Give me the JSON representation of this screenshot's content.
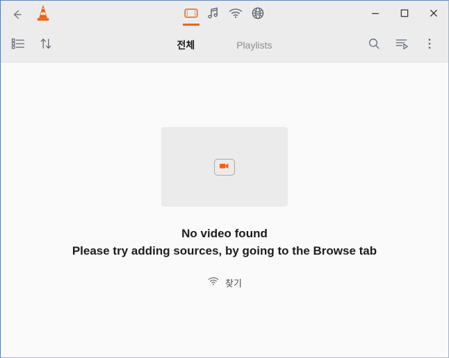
{
  "window": {
    "accent_color": "#f4610a",
    "titlebar_bg": "#ececec",
    "content_bg": "#fafafa"
  },
  "titlebar": {
    "back_label": "back-arrow",
    "app_logo": "vlc-cone-logo",
    "tabs": [
      {
        "id": "video",
        "icon": "video-filmstrip-icon",
        "selected": true
      },
      {
        "id": "music",
        "icon": "music-note-icon",
        "selected": false
      },
      {
        "id": "network",
        "icon": "wifi-icon",
        "selected": false
      },
      {
        "id": "browse",
        "icon": "globe-icon",
        "selected": false
      }
    ],
    "window_controls": [
      {
        "id": "minimize",
        "icon": "minimize-icon"
      },
      {
        "id": "maximize",
        "icon": "maximize-icon"
      },
      {
        "id": "close",
        "icon": "close-icon"
      }
    ]
  },
  "toolbar": {
    "left_icons": [
      {
        "id": "view-mode",
        "icon": "list-view-icon"
      },
      {
        "id": "sort",
        "icon": "sort-arrows-icon"
      }
    ],
    "subtabs": [
      {
        "label": "전체",
        "active": true
      },
      {
        "label": "Playlists",
        "active": false
      }
    ],
    "right_icons": [
      {
        "id": "search",
        "icon": "search-icon"
      },
      {
        "id": "playlist-queue",
        "icon": "playlist-play-icon"
      },
      {
        "id": "more-options",
        "icon": "overflow-menu-icon"
      }
    ]
  },
  "content": {
    "placeholder_icon": "video-camera-icon",
    "title": "No video found",
    "subtitle": "Please try adding sources, by going to the Browse tab",
    "browse_action": {
      "icon": "wifi-icon",
      "label": "찾기"
    }
  }
}
